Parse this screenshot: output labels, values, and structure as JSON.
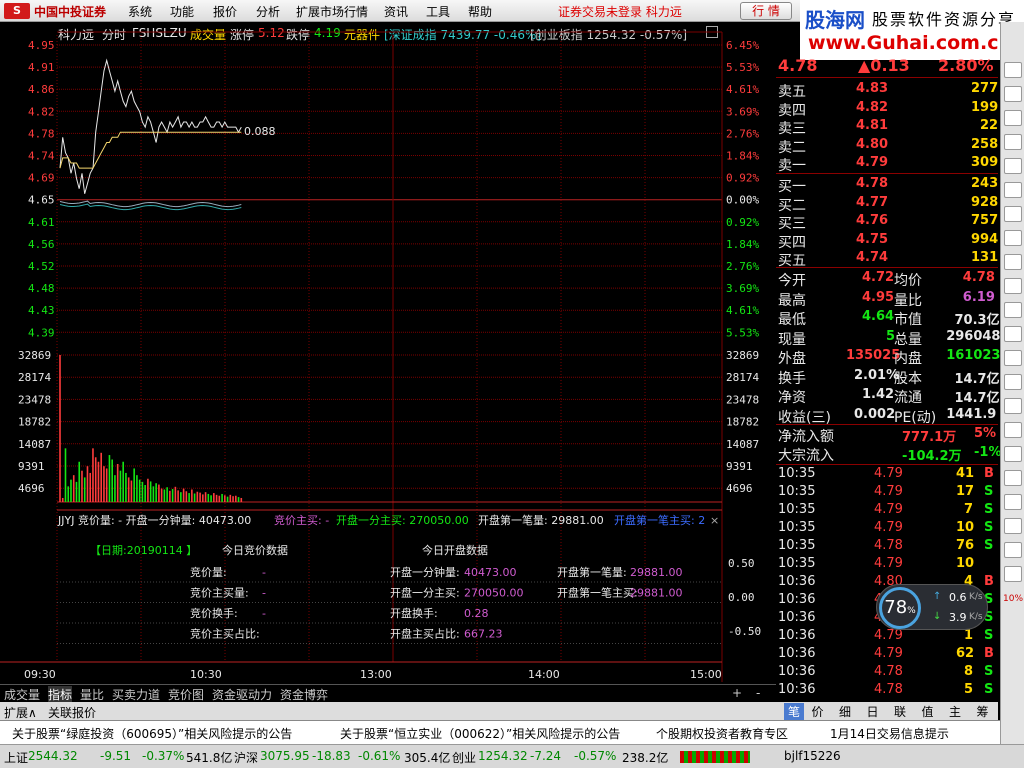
{
  "menubar": {
    "logo_text": "中国中投证券",
    "items": [
      "系统",
      "功能",
      "报价",
      "分析",
      "扩展市场行情",
      "资讯",
      "工具",
      "帮助"
    ],
    "warning": "证券交易未登录  科力远",
    "quote_btn": "行 情"
  },
  "brand": {
    "line1": "股海网",
    "line2": "股票软件资源分享",
    "line3": "www.Guhai.com.cn"
  },
  "toolbar": {
    "stock": "科力远",
    "mode": "分时",
    "code": "FSHSLZU",
    "vol_label": "成交量",
    "limit_up_label": "涨停",
    "limit_up": "5.12",
    "limit_down_label": "跌停",
    "limit_down": "4.19",
    "unit": "元器件",
    "idx1": "[深证成指 7439.77 -0.46%]",
    "idx2": "[创业板指 1254.32 -0.57%]"
  },
  "price_axis": {
    "left": [
      "4.95",
      "4.91",
      "4.86",
      "4.82",
      "4.78",
      "4.74",
      "4.69",
      "4.65",
      "4.61",
      "4.56",
      "4.52",
      "4.48",
      "4.43",
      "4.39"
    ],
    "right": [
      "6.45%",
      "5.53%",
      "4.61%",
      "3.69%",
      "2.76%",
      "1.84%",
      "0.92%",
      "0.00%",
      "0.92%",
      "1.84%",
      "2.76%",
      "3.69%",
      "4.61%",
      "5.53%"
    ]
  },
  "vol_axis": [
    "32869",
    "28174",
    "23478",
    "18782",
    "14087",
    "9391",
    "4696"
  ],
  "ind_axis": [
    "0.50",
    "0.00",
    "-0.50"
  ],
  "time_axis": [
    "09:30",
    "10:30",
    "13:00",
    "14:00",
    "15:00"
  ],
  "chart_data": {
    "type": "line",
    "title": "",
    "xlabel": "",
    "ylabel": "",
    "ylim": [
      4.39,
      4.95
    ],
    "prev_close": 4.65,
    "x": [
      "09:30",
      "09:31",
      "09:32",
      "09:33",
      "09:34",
      "09:35",
      "09:36",
      "09:37",
      "09:38",
      "09:39",
      "09:40",
      "09:41",
      "09:42",
      "09:43",
      "09:44",
      "09:45",
      "09:46",
      "09:47",
      "09:48",
      "09:49",
      "09:50",
      "09:51",
      "09:52",
      "09:53",
      "09:54",
      "09:55",
      "09:56",
      "09:57",
      "09:58",
      "09:59",
      "10:00",
      "10:01",
      "10:02",
      "10:03",
      "10:04",
      "10:05",
      "10:06",
      "10:07",
      "10:08",
      "10:09",
      "10:10",
      "10:11",
      "10:12",
      "10:13",
      "10:14",
      "10:15",
      "10:16",
      "10:17",
      "10:18",
      "10:19",
      "10:20",
      "10:21",
      "10:22",
      "10:23",
      "10:24",
      "10:25",
      "10:26",
      "10:27",
      "10:28",
      "10:29",
      "10:30",
      "10:31",
      "10:32",
      "10:33",
      "10:34",
      "10:35",
      "10:36"
    ],
    "series": [
      {
        "values": [
          4.71,
          4.77,
          4.74,
          4.73,
          4.7,
          4.72,
          4.69,
          4.67,
          4.7,
          4.66,
          4.68,
          4.7,
          4.71,
          4.78,
          4.82,
          4.86,
          4.9,
          4.92,
          4.9,
          4.88,
          4.86,
          4.88,
          4.86,
          4.84,
          4.83,
          4.85,
          4.86,
          4.84,
          4.83,
          4.82,
          4.8,
          4.79,
          4.81,
          4.8,
          4.78,
          4.76,
          4.79,
          4.8,
          4.79,
          4.78,
          4.8,
          4.79,
          4.8,
          4.81,
          4.79,
          4.8,
          4.8,
          4.79,
          4.8,
          4.79,
          4.79,
          4.8,
          4.8,
          4.81,
          4.8,
          4.79,
          4.79,
          4.8,
          4.8,
          4.79,
          4.8,
          4.79,
          4.79,
          4.79,
          4.79,
          4.78,
          4.79
        ]
      },
      {
        "values": [
          4.71,
          4.73,
          4.73,
          4.73,
          4.72,
          4.72,
          4.72,
          4.71,
          4.71,
          4.71,
          4.71,
          4.71,
          4.71,
          4.72,
          4.73,
          4.74,
          4.75,
          4.76,
          4.76,
          4.77,
          4.77,
          4.77,
          4.78,
          4.78,
          4.78,
          4.78,
          4.78,
          4.78,
          4.78,
          4.78,
          4.78,
          4.78,
          4.78,
          4.78,
          4.78,
          4.78,
          4.78,
          4.78,
          4.78,
          4.78,
          4.78,
          4.78,
          4.78,
          4.78,
          4.78,
          4.78,
          4.78,
          4.78,
          4.78,
          4.78,
          4.78,
          4.78,
          4.78,
          4.78,
          4.78,
          4.78,
          4.78,
          4.78,
          4.78,
          4.78,
          4.78,
          4.78,
          4.78,
          4.78,
          4.78,
          4.78,
          4.78
        ]
      }
    ],
    "volume": [
      32869,
      900,
      12000,
      3500,
      5000,
      6000,
      4500,
      9000,
      7000,
      5500,
      8000,
      6500,
      12000,
      10000,
      9000,
      11000,
      8000,
      7500,
      10500,
      9500,
      6000,
      8500,
      7000,
      9000,
      6500,
      5500,
      4800,
      7500,
      6000,
      5000,
      4500,
      3800,
      5200,
      4600,
      3500,
      4200,
      3900,
      3000,
      2800,
      3300,
      2500,
      2900,
      3400,
      2600,
      2200,
      3000,
      2400,
      2000,
      2800,
      1900,
      2300,
      2100,
      1700,
      2200,
      1800,
      1500,
      2000,
      1600,
      1400,
      1800,
      1500,
      1200,
      1600,
      1300,
      1400,
      1100,
      900
    ]
  },
  "ma_label": "0.088",
  "indicator_bar": "JJYJ 竞价量: -  开盘一分钟量: 40473.00",
  "indicator_bar2": "竞价主买: -",
  "indicator_bar3": "开盘一分主买: 270050.00",
  "indicator_bar4": "开盘第一笔量: 29881.00",
  "indicator_bar5": "开盘第一笔主买: 2",
  "auction": {
    "date": "【日期:20190114 】",
    "today_auction": "今日竞价数据",
    "today_open": "今日开盘数据",
    "rows": [
      [
        "竞价量:",
        "-",
        "开盘一分钟量:",
        "40473.00",
        "开盘第一笔量:",
        "29881.00"
      ],
      [
        "竞价主买量:",
        "-",
        "开盘一分主买:",
        "270050.00",
        "开盘第一笔主买:",
        "29881.00"
      ],
      [
        "竞价换手:",
        "-",
        "开盘换手:",
        "0.28",
        "",
        ""
      ],
      [
        "竞价主买占比:",
        "",
        "开盘主买占比:",
        "667.23",
        "",
        ""
      ]
    ]
  },
  "bottom_tabs": [
    "成交量",
    "指标",
    "量比",
    "买卖力道",
    "竞价图",
    "资金驱动力",
    "资金博弈"
  ],
  "bottom_tabs2": [
    "扩展∧",
    "关联报价"
  ],
  "news": [
    "关于股票“绿庭投资（600695）”相关风险提示的公告",
    "关于股票“恒立实业（000622）”相关风险提示的公告",
    "个股期权投资者教育专区",
    "1月14日交易信息提示"
  ],
  "status": {
    "sh_label": "上证",
    "sh": "2544.32",
    "sh_chg": "-9.51",
    "sh_pct": "-0.37%",
    "sh_amt": "541.8亿",
    "sz_label": "沪深",
    "sz": "3075.95",
    "sz_chg": "-18.83",
    "sz_pct": "-0.61%",
    "sz_amt": "305.4亿",
    "cy_label": "创业",
    "cy": "1254.32",
    "cy_chg": "-7.24",
    "cy_pct": "-0.57%",
    "cy_amt": "238.2亿",
    "user": "bjlf15226"
  },
  "quote": {
    "price": "4.78",
    "chg": "▲0.13",
    "pct": "2.80%",
    "asks": [
      [
        "卖五",
        "4.83",
        "277"
      ],
      [
        "卖四",
        "4.82",
        "199"
      ],
      [
        "卖三",
        "4.81",
        "22"
      ],
      [
        "卖二",
        "4.80",
        "258"
      ],
      [
        "卖一",
        "4.79",
        "309"
      ]
    ],
    "bids": [
      [
        "买一",
        "4.78",
        "243"
      ],
      [
        "买二",
        "4.77",
        "928"
      ],
      [
        "买三",
        "4.76",
        "757"
      ],
      [
        "买四",
        "4.75",
        "994"
      ],
      [
        "买五",
        "4.74",
        "131"
      ]
    ],
    "stats": [
      [
        "今开",
        "4.72",
        "均价",
        "4.78"
      ],
      [
        "最高",
        "4.95",
        "量比",
        "6.19"
      ],
      [
        "最低",
        "4.64",
        "市值",
        "70.3亿"
      ],
      [
        "现量",
        "5",
        "总量",
        "296048"
      ],
      [
        "外盘",
        "135025",
        "内盘",
        "161023"
      ],
      [
        "换手",
        "2.01%",
        "股本",
        "14.7亿"
      ],
      [
        "净资",
        "1.42",
        "流通",
        "14.7亿"
      ],
      [
        "收益(三)",
        "0.002",
        "PE(动)",
        "1441.9"
      ]
    ],
    "flow": [
      [
        "净流入额",
        "777.1万",
        "5%"
      ],
      [
        "大宗流入",
        "-104.2万",
        "-1%"
      ]
    ],
    "ticks": [
      [
        "10:35",
        "4.79",
        "41",
        "B"
      ],
      [
        "10:35",
        "4.79",
        "17",
        "S"
      ],
      [
        "10:35",
        "4.79",
        "7",
        "S"
      ],
      [
        "10:35",
        "4.79",
        "10",
        "S"
      ],
      [
        "10:35",
        "4.78",
        "76",
        "S"
      ],
      [
        "10:35",
        "4.79",
        "10",
        ""
      ],
      [
        "10:36",
        "4.80",
        "4",
        "B"
      ],
      [
        "10:36",
        "4.79",
        "10",
        "S"
      ],
      [
        "10:36",
        "4.79",
        "1",
        "S"
      ],
      [
        "10:36",
        "4.79",
        "1",
        "S"
      ],
      [
        "10:36",
        "4.79",
        "62",
        "B"
      ],
      [
        "10:36",
        "4.78",
        "8",
        "S"
      ],
      [
        "10:36",
        "4.78",
        "5",
        "S"
      ]
    ],
    "tabs": [
      "笔",
      "价",
      "细",
      "日",
      "联",
      "值",
      "主",
      "筹"
    ]
  },
  "gauge": {
    "pct": "78",
    "up": "0.6",
    "down": "3.9",
    "unit": "K/s"
  },
  "side": [
    "10%"
  ]
}
